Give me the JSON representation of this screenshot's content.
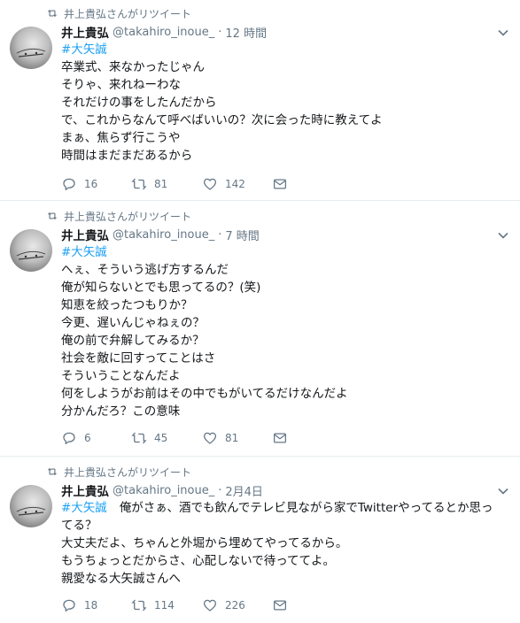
{
  "tweets": [
    {
      "retweeted_by": "井上貴弘さんがリツイート",
      "author_name": "井上貴弘",
      "author_handle": "@takahiro_inoue_",
      "time": "12 時間",
      "hashtag": "#大矢誠",
      "lines": [
        "卒業式、来なかったじゃん",
        "そりゃ、来れねーわな",
        "それだけの事をしたんだから",
        "で、これからなんて呼べばいいの？次に会った時に教えてよ",
        "まぁ、焦らず行こうや",
        "時間はまだまだあるから"
      ],
      "replies": "16",
      "retweets": "81",
      "likes": "142"
    },
    {
      "retweeted_by": "井上貴弘さんがリツイート",
      "author_name": "井上貴弘",
      "author_handle": "@takahiro_inoue_",
      "time": "7 時間",
      "hashtag": "#大矢誠",
      "lines": [
        "へぇ、そういう逃げ方するんだ",
        "俺が知らないとでも思ってるの？(笑)",
        "知恵を絞ったつもりか？",
        "今更、遅いんじゃねぇの？",
        "俺の前で弁解してみるか？",
        "社会を敵に回すってことはさ",
        "そういうことなんだよ",
        "何をしようがお前はその中でもがいてるだけなんだよ",
        "分かんだろ？この意味"
      ],
      "replies": "6",
      "retweets": "45",
      "likes": "81"
    },
    {
      "retweeted_by": "井上貴弘さんがリツイート",
      "author_name": "井上貴弘",
      "author_handle": "@takahiro_inoue_",
      "time": "2月4日",
      "hashtag": "#大矢誠",
      "first_line_text": "俺がさぁ、酒でも飲んでテレビ見ながら家でTwitterやってるとか思ってる？",
      "lines": [
        "大丈夫だよ、ちゃんと外堀から埋めてやってるから。",
        "もうちょっとだからさ、心配しないで待っててよ。",
        "親愛なる大矢誠さんへ"
      ],
      "replies": "18",
      "retweets": "114",
      "likes": "226"
    }
  ],
  "icons": {
    "retweet_context": "retweet-icon",
    "reply": "reply-icon",
    "retweet": "retweet-icon",
    "like": "heart-icon",
    "dm": "envelope-icon",
    "caret": "chevron-down-icon"
  },
  "colors": {
    "hashtag": "#1da1f2",
    "meta_text": "#657786",
    "divider": "#e6ecf0"
  }
}
